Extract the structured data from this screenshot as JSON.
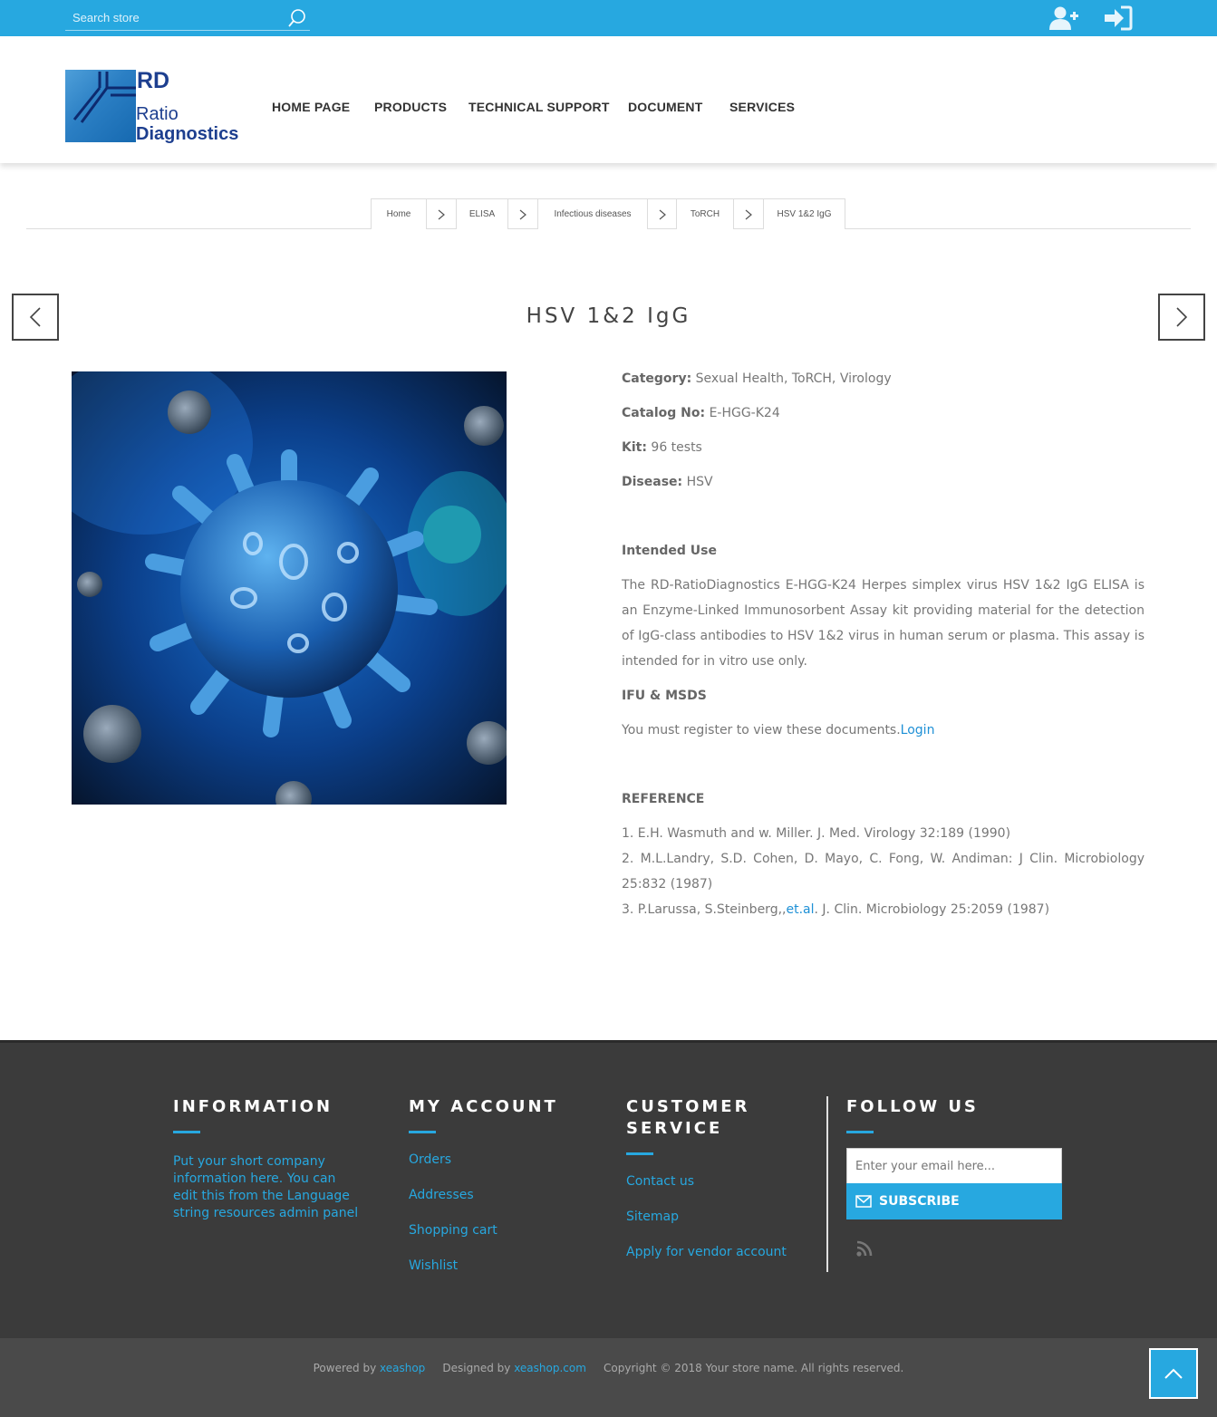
{
  "topbar": {
    "search_placeholder": "Search store",
    "icons": [
      "search-icon",
      "register-icon",
      "login-icon"
    ]
  },
  "logo": {
    "line1": "RD",
    "line2": "Ratio",
    "line3": "Diagnostics"
  },
  "nav": [
    "HOME PAGE",
    "PRODUCTS",
    "TECHNICAL SUPPORT",
    "DOCUMENT",
    "SERVICES"
  ],
  "breadcrumb": [
    "Home",
    "ELISA",
    "Infectious diseases",
    "ToRCH",
    "HSV 1&2 IgG"
  ],
  "product": {
    "title": "HSV 1&2 IgG",
    "category_label": "Category:",
    "category_value": "Sexual Health, ToRCH, Virology",
    "catalog_label": "Catalog No:",
    "catalog_value": "E-HGG-K24",
    "kit_label": "Kit:",
    "kit_value": "96 tests",
    "disease_label": "Disease:",
    "disease_value": "HSV",
    "intended_heading": "Intended Use",
    "intended_text": "The RD-RatioDiagnostics E-HGG-K24 Herpes simplex virus HSV 1&2 IgG ELISA is an Enzyme-Linked Immunosorbent Assay kit providing material for the detection of IgG-class antibodies to HSV 1&2 virus in human serum or plasma. This assay is intended for in vitro use only.",
    "ifu_heading": "IFU & MSDS",
    "register_text": "You must register to view these documents.",
    "login_link": "Login",
    "reference_heading": "REFERENCE",
    "ref1": "1. E.H. Wasmuth and w. Miller. J. Med. Virology 32:189 (1990)",
    "ref2": "2. M.L.Landry, S.D. Cohen, D. Mayo, C. Fong, W. Andiman: J Clin. Microbiology 25:832 (1987)",
    "ref3_pre": "3. P.Larussa, S.Steinberg,,",
    "ref3_link": "et.al",
    "ref3_post": ". J. Clin. Microbiology 25:2059 (1987)"
  },
  "footer": {
    "info_heading": "INFORMATION",
    "info_text": "Put your short company information here. You can edit this from the Language string resources admin panel",
    "account_heading": "MY ACCOUNT",
    "account_links": [
      "Orders",
      "Addresses",
      "Shopping cart",
      "Wishlist"
    ],
    "service_heading": "CUSTOMER SERVICE",
    "service_links": [
      "Contact us",
      "Sitemap",
      "Apply for vendor account"
    ],
    "follow_heading": "FOLLOW US",
    "email_placeholder": "Enter your email here...",
    "subscribe_label": "SUBSCRIBE",
    "powered_prefix": "Powered by",
    "powered_link": "xeashop",
    "designed_prefix": "Designed by",
    "designed_link": "xeashop.com",
    "copyright": "Copyright © 2018 Your store name. All rights reserved."
  },
  "colors": {
    "accent": "#27a8e0",
    "footer_bg": "#3b3b3b",
    "footer_bottom": "#4a4a4a"
  }
}
